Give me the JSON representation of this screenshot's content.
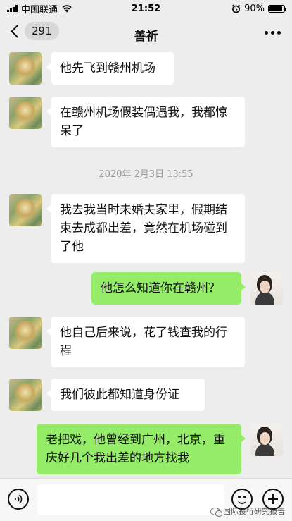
{
  "status_bar": {
    "carrier": "中国联通",
    "time": "21:52",
    "battery": "90%",
    "battery_level": 0.9
  },
  "nav": {
    "back_count": "291",
    "title": "善祈"
  },
  "chat": {
    "messages": [
      {
        "side": "left",
        "text": "他先飞到赣州机场"
      },
      {
        "side": "left",
        "text": "在赣州机场假装偶遇我，我都惊呆了"
      },
      {
        "side": "left",
        "text": "我去我当时未婚夫家里，假期结束去成都出差，竟然在机场碰到了他"
      },
      {
        "side": "right",
        "text": "他怎么知道你在赣州？"
      },
      {
        "side": "left",
        "text": "他自己后来说，花了钱查我的行程"
      },
      {
        "side": "left",
        "text": "我们彼此都知道身份证"
      },
      {
        "side": "right",
        "text": "老把戏，他曾经到广州，北京，重庆好几个我出差的地方找我"
      }
    ],
    "timestamp": "2020年 2月3日 13:55"
  },
  "input": {
    "placeholder": ""
  },
  "watermark": "国际投行研究报告",
  "colors": {
    "background": "#ededed",
    "bubble_self": "#95ec69",
    "bubble_other": "#ffffff"
  }
}
